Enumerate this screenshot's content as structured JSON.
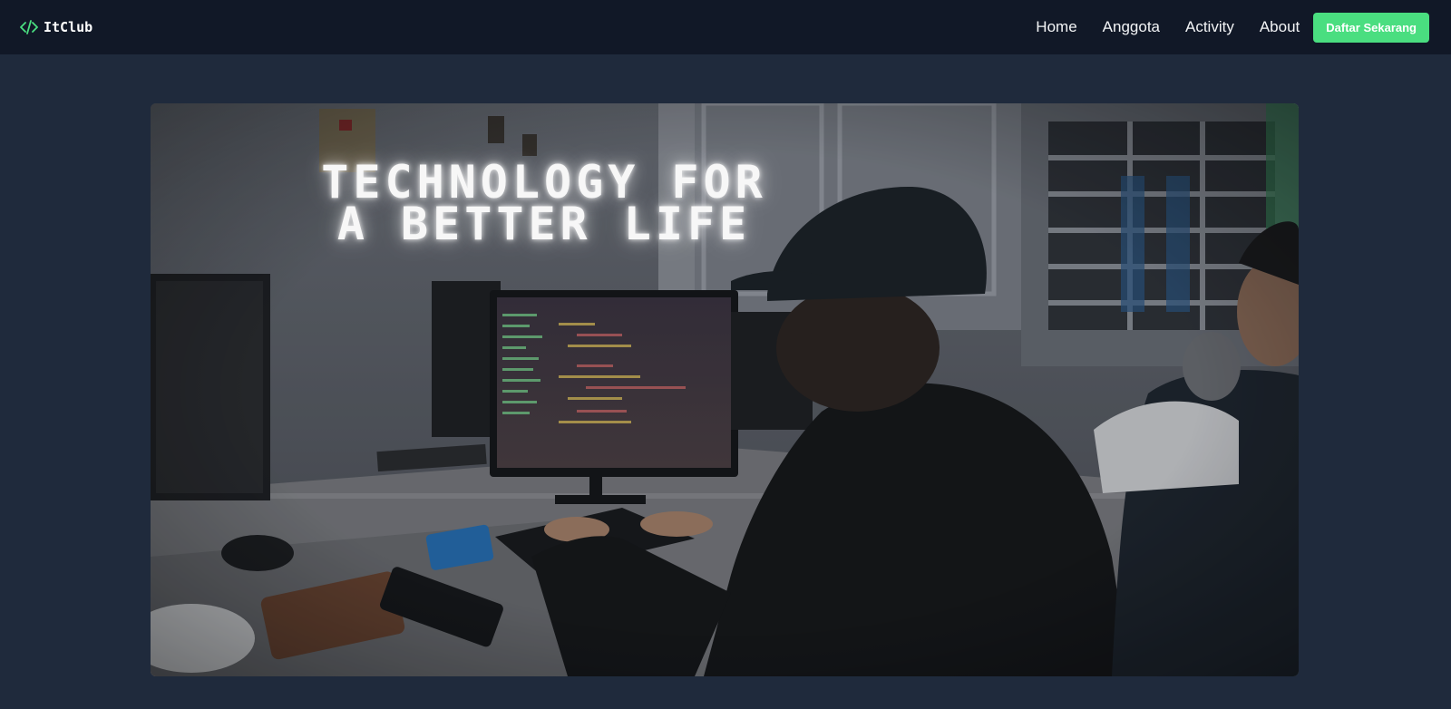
{
  "navbar": {
    "brand_icon": "code-icon",
    "brand_name": "ItClub",
    "links": [
      "Home",
      "Anggota",
      "Activity",
      "About"
    ],
    "cta_label": "Daftar Sekarang"
  },
  "hero": {
    "title_line1": "TECHNOLOGY FOR",
    "title_line2": "A BETTER LIFE",
    "image_subject": "student-coding-at-computer-lab"
  },
  "colors": {
    "page_bg": "#1f2a3c",
    "navbar_bg": "#111827",
    "accent": "#4ade80",
    "text": "#ffffff"
  }
}
